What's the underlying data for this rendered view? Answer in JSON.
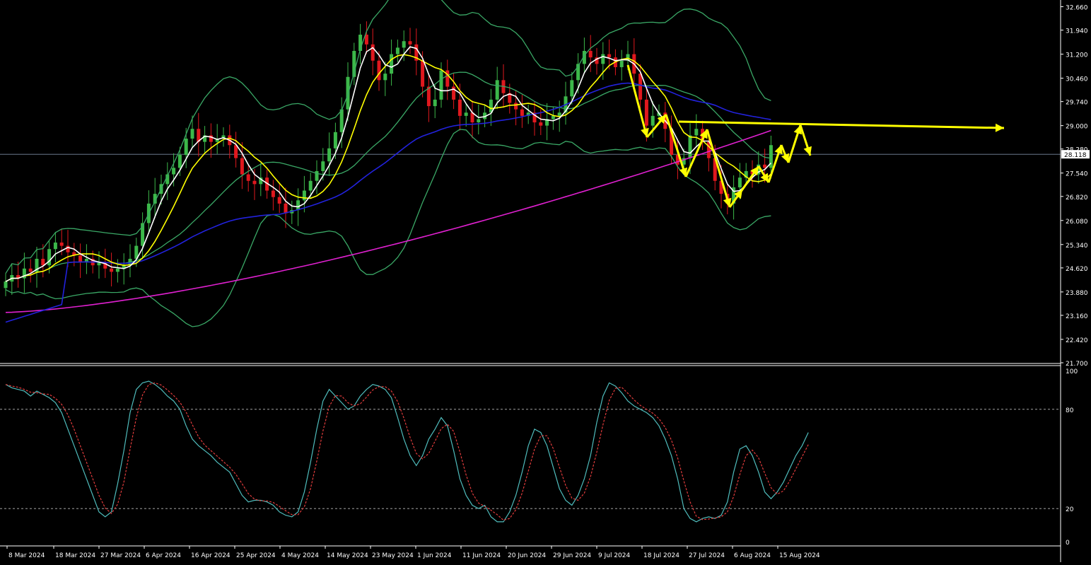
{
  "chart_data": [
    {
      "type": "candlestick",
      "title": "",
      "y_axis_labels": [
        "32.660",
        "31.940",
        "31.200",
        "30.460",
        "29.740",
        "29.000",
        "28.280",
        "27.540",
        "26.820",
        "26.080",
        "25.340",
        "24.620",
        "23.880",
        "23.160",
        "22.420",
        "21.700"
      ],
      "y_range": [
        21.7,
        32.78
      ],
      "current_price": "28.118",
      "date_labels": [
        "8 Mar 2024",
        "18 Mar 2024",
        "27 Mar 2024",
        "6 Apr 2024",
        "16 Apr 2024",
        "25 Apr 2024",
        "4 May 2024",
        "14 May 2024",
        "23 May 2024",
        "1 Jun 2024",
        "11 Jun 2024",
        "20 Jun 2024",
        "29 Jun 2024",
        "9 Jul 2024",
        "18 Jul 2024",
        "27 Jul 2024",
        "6 Aug 2024",
        "15 Aug 2024"
      ],
      "colors": {
        "up": "#3cb84a",
        "down": "#e0181e",
        "ma_fast": "#ffffff",
        "ma_mid": "#ffff00",
        "ma_slow": "#2222dd",
        "ma_long": "#e020d0",
        "bands": "#3aa866",
        "annotation": "#ffff00"
      },
      "closes": [
        24.2,
        24.4,
        24.3,
        24.6,
        24.5,
        24.9,
        24.7,
        25.2,
        25.4,
        25.3,
        25.1,
        25.0,
        24.8,
        24.9,
        24.7,
        24.8,
        24.6,
        24.5,
        24.6,
        24.7,
        24.9,
        25.3,
        26.0,
        26.6,
        26.9,
        27.2,
        27.5,
        27.7,
        28.1,
        28.6,
        28.9,
        28.5,
        28.7,
        28.5,
        28.6,
        28.7,
        28.4,
        28.0,
        27.5,
        27.3,
        27.2,
        27.4,
        27.0,
        26.8,
        26.6,
        26.3,
        26.4,
        26.7,
        27.0,
        27.3,
        27.6,
        27.9,
        28.3,
        28.8,
        29.5,
        30.5,
        31.3,
        31.8,
        31.5,
        31.0,
        30.4,
        30.6,
        31.2,
        31.4,
        31.6,
        31.5,
        31.0,
        30.2,
        29.6,
        29.8,
        30.7,
        30.2,
        29.8,
        29.3,
        29.4,
        29.1,
        29.2,
        29.4,
        29.8,
        30.4,
        30.0,
        29.7,
        29.5,
        29.3,
        29.4,
        29.1,
        29.0,
        29.2,
        29.3,
        29.4,
        29.9,
        30.4,
        30.9,
        31.3,
        31.1,
        30.9,
        31.2,
        31.1,
        30.8,
        31.0,
        31.2,
        30.6,
        29.8,
        29.0,
        29.3,
        29.4,
        28.9,
        28.1,
        27.8,
        28.0,
        28.7,
        28.9,
        28.5,
        28.0,
        27.3,
        26.9,
        26.6,
        27.1,
        27.4,
        27.6,
        27.5,
        27.8,
        27.7,
        28.4
      ]
    },
    {
      "type": "line",
      "title": "",
      "y_axis_labels": [
        "100",
        "80",
        "20",
        "0"
      ],
      "levels": [
        80,
        20
      ],
      "y_range": [
        0,
        100
      ],
      "colors": {
        "main": "#4fbcbc",
        "signal": "#e03c3c",
        "level": "#bbbbbb"
      },
      "main_values": [
        95,
        93,
        92,
        91,
        88,
        91,
        89,
        87,
        84,
        78,
        68,
        58,
        48,
        38,
        28,
        18,
        15,
        18,
        35,
        55,
        78,
        92,
        96,
        97,
        95,
        92,
        88,
        85,
        80,
        70,
        62,
        58,
        55,
        52,
        48,
        45,
        42,
        35,
        28,
        24,
        25,
        25,
        24,
        22,
        18,
        16,
        15,
        18,
        30,
        48,
        68,
        85,
        92,
        88,
        84,
        80,
        82,
        88,
        92,
        95,
        94,
        92,
        87,
        75,
        62,
        52,
        46,
        52,
        62,
        68,
        75,
        70,
        55,
        38,
        28,
        22,
        20,
        22,
        15,
        12,
        12,
        18,
        28,
        42,
        58,
        68,
        66,
        58,
        45,
        32,
        25,
        22,
        28,
        38,
        52,
        72,
        88,
        96,
        94,
        90,
        85,
        82,
        80,
        78,
        75,
        70,
        62,
        52,
        38,
        20,
        14,
        12,
        14,
        15,
        14,
        16,
        24,
        42,
        56,
        58,
        52,
        42,
        30,
        26,
        30,
        36,
        44,
        52,
        58,
        66
      ]
    }
  ]
}
